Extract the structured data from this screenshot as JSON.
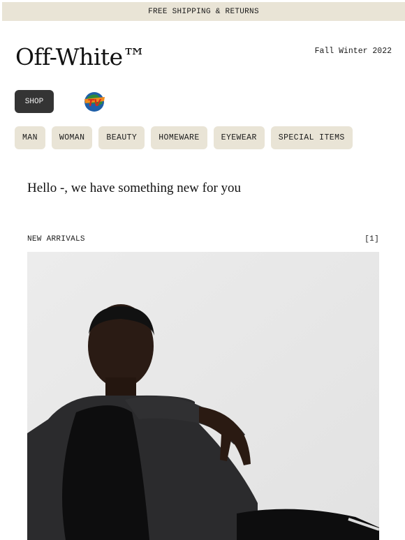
{
  "topbar": {
    "text": "FREE SHIPPING & RETURNS"
  },
  "header": {
    "logo": "Off-White™",
    "season": "Fall Winter 2022"
  },
  "nav": {
    "shop_label": "SHOP",
    "tv_label": "TV",
    "categories": [
      "MAN",
      "WOMAN",
      "BEAUTY",
      "HOMEWARE",
      "EYEWEAR",
      "SPECIAL ITEMS"
    ]
  },
  "greeting": "Hello -, we have something new for you",
  "section": {
    "title": "NEW ARRIVALS",
    "count": "[1]"
  },
  "colors": {
    "accent_bg": "#e9e4d6",
    "button_dark": "#343434",
    "tv_red": "#d62a1e",
    "tv_blue": "#1f5fa8"
  }
}
